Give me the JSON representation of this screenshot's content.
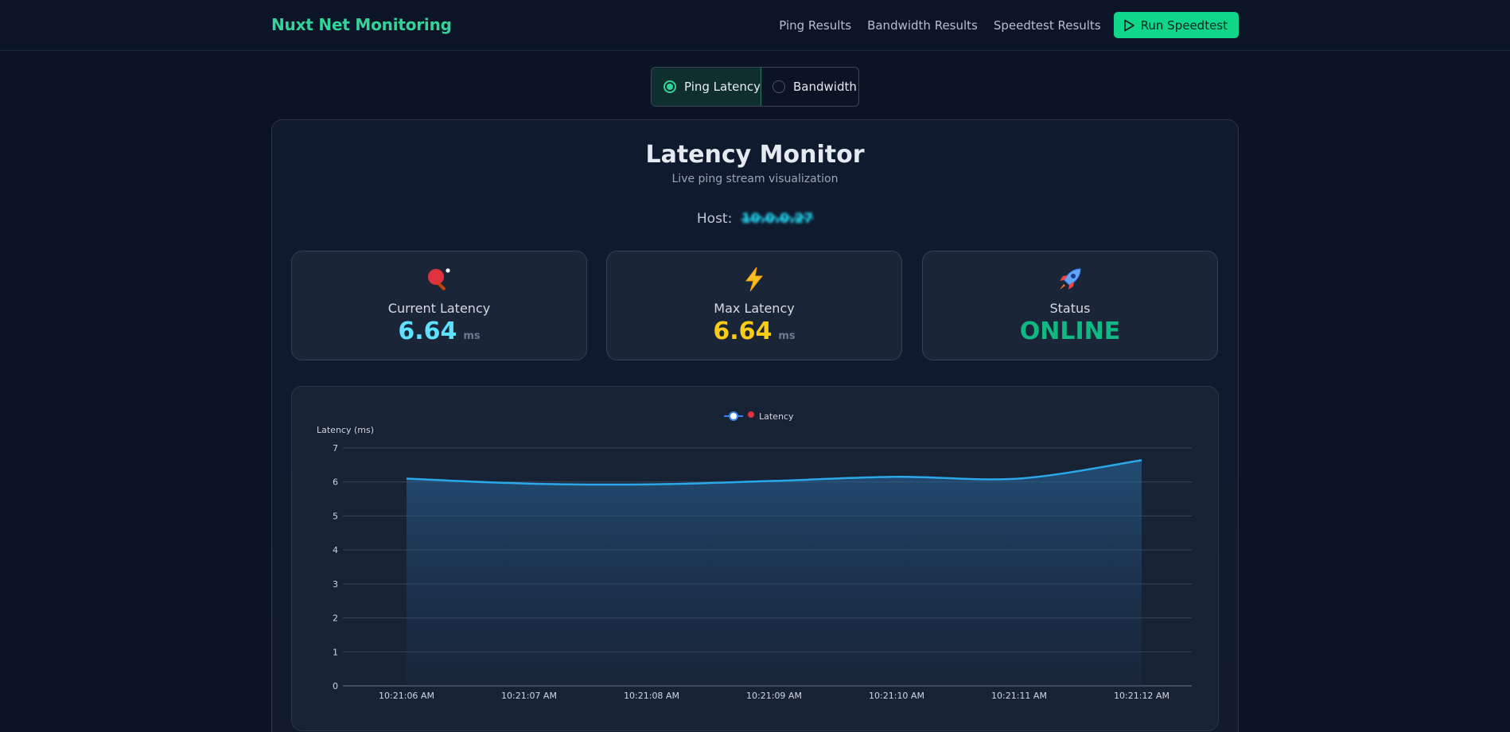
{
  "nav": {
    "brand": "Nuxt Net Monitoring",
    "links": [
      "Ping Results",
      "Bandwidth Results",
      "Speedtest Results"
    ],
    "run_button": "Run Speedtest"
  },
  "toggle": {
    "options": [
      "Ping Latency",
      "Bandwidth"
    ],
    "selected": "Ping Latency"
  },
  "monitor": {
    "title": "Latency Monitor",
    "subtitle": "Live ping stream visualization",
    "host_label": "Host:",
    "host_value": "10.0.0.27"
  },
  "stats": [
    {
      "icon": "ping-pong-icon",
      "label": "Current Latency",
      "value": "6.64",
      "unit": "ms",
      "color": "#5ee0ff"
    },
    {
      "icon": "lightning-icon",
      "label": "Max Latency",
      "value": "6.64",
      "unit": "ms",
      "color": "#facc15"
    },
    {
      "icon": "rocket-icon",
      "label": "Status",
      "value": "ONLINE",
      "unit": "",
      "color": "#10b981"
    }
  ],
  "chart_data": {
    "type": "area",
    "legend": "Latency",
    "legend_position": "top-center",
    "ylabel": "Latency (ms)",
    "ylim": [
      0,
      7
    ],
    "yticks": [
      0,
      1,
      2,
      3,
      4,
      5,
      6,
      7
    ],
    "grid": true,
    "x": [
      "10:21:06 AM",
      "10:21:07 AM",
      "10:21:08 AM",
      "10:21:09 AM",
      "10:21:10 AM",
      "10:21:11 AM",
      "10:21:12 AM"
    ],
    "series": [
      {
        "name": "Latency",
        "values": [
          6.1,
          5.95,
          5.93,
          6.03,
          6.15,
          6.1,
          6.64
        ]
      }
    ],
    "line_color": "#2aa8ea"
  }
}
